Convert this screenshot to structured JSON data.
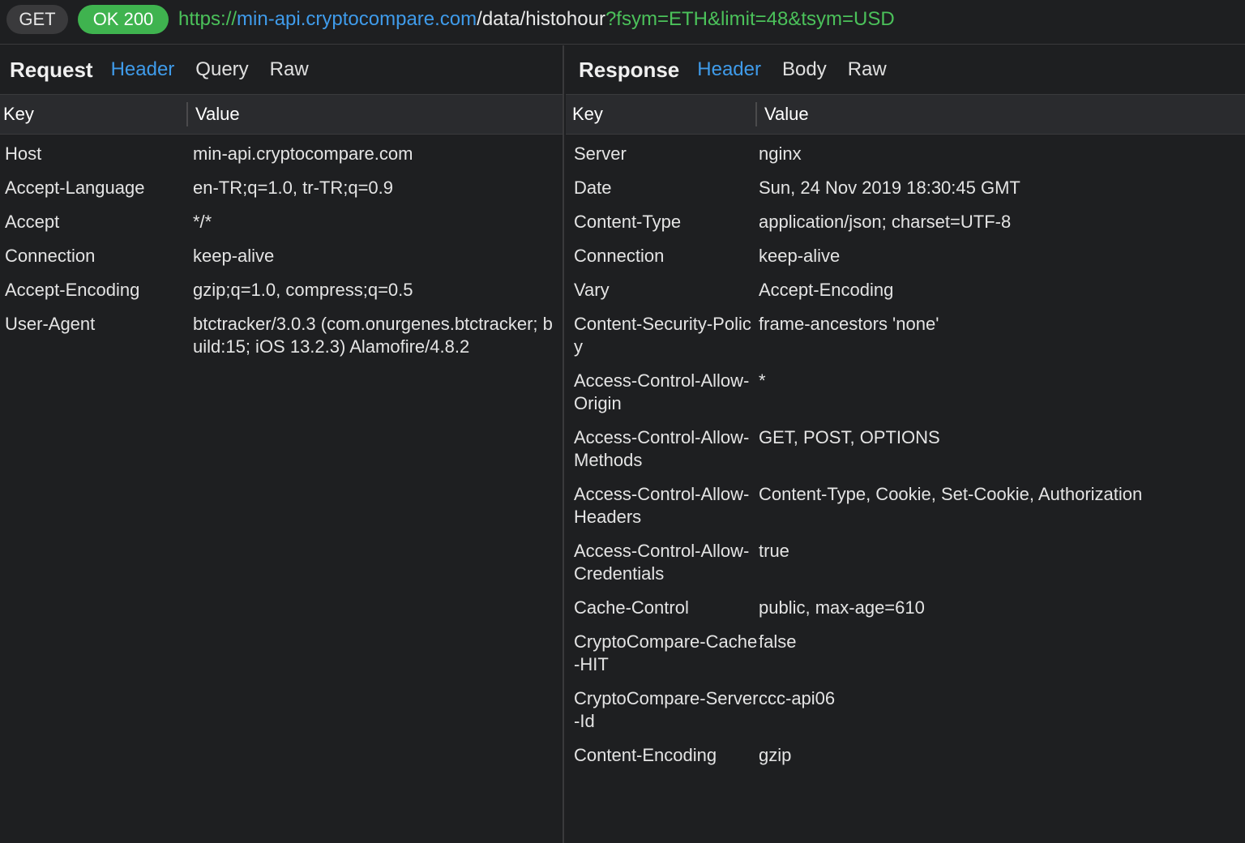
{
  "topbar": {
    "method": "GET",
    "status": "OK 200",
    "url_scheme": "https://",
    "url_host": "min-api.cryptocompare.com",
    "url_path": "/data/histohour",
    "url_query": "?fsym=ETH&limit=48&tsym=USD"
  },
  "request": {
    "title": "Request",
    "tabs": [
      "Header",
      "Query",
      "Raw"
    ],
    "active_tab": "Header",
    "col_key": "Key",
    "col_value": "Value",
    "headers": [
      {
        "key": "Host",
        "value": "min-api.cryptocompare.com"
      },
      {
        "key": "Accept-Language",
        "value": "en-TR;q=1.0, tr-TR;q=0.9"
      },
      {
        "key": "Accept",
        "value": "*/*"
      },
      {
        "key": "Connection",
        "value": "keep-alive"
      },
      {
        "key": "Accept-Encoding",
        "value": "gzip;q=1.0, compress;q=0.5"
      },
      {
        "key": "User-Agent",
        "value": "btctracker/3.0.3 (com.onurgenes.btctracker; build:15; iOS 13.2.3) Alamofire/4.8.2"
      }
    ]
  },
  "response": {
    "title": "Response",
    "tabs": [
      "Header",
      "Body",
      "Raw"
    ],
    "active_tab": "Header",
    "col_key": "Key",
    "col_value": "Value",
    "headers": [
      {
        "key": "Server",
        "value": "nginx"
      },
      {
        "key": "Date",
        "value": "Sun, 24 Nov 2019 18:30:45 GMT"
      },
      {
        "key": "Content-Type",
        "value": "application/json; charset=UTF-8"
      },
      {
        "key": "Connection",
        "value": "keep-alive"
      },
      {
        "key": "Vary",
        "value": "Accept-Encoding"
      },
      {
        "key": "Content-Security-Policy",
        "value": "frame-ancestors 'none'"
      },
      {
        "key": "Access-Control-Allow-Origin",
        "value": "*"
      },
      {
        "key": "Access-Control-Allow-Methods",
        "value": "GET, POST, OPTIONS"
      },
      {
        "key": "Access-Control-Allow-Headers",
        "value": "Content-Type, Cookie, Set-Cookie, Authorization"
      },
      {
        "key": "Access-Control-Allow-Credentials",
        "value": "true"
      },
      {
        "key": "Cache-Control",
        "value": "public, max-age=610"
      },
      {
        "key": "CryptoCompare-Cache-HIT",
        "value": "false"
      },
      {
        "key": "CryptoCompare-Server-Id",
        "value": "ccc-api06"
      },
      {
        "key": "Content-Encoding",
        "value": "gzip"
      }
    ]
  },
  "colors": {
    "background": "#1e1f21",
    "accent_blue": "#3f9bea",
    "status_green": "#3fb34f",
    "url_green": "#4bc15a"
  }
}
